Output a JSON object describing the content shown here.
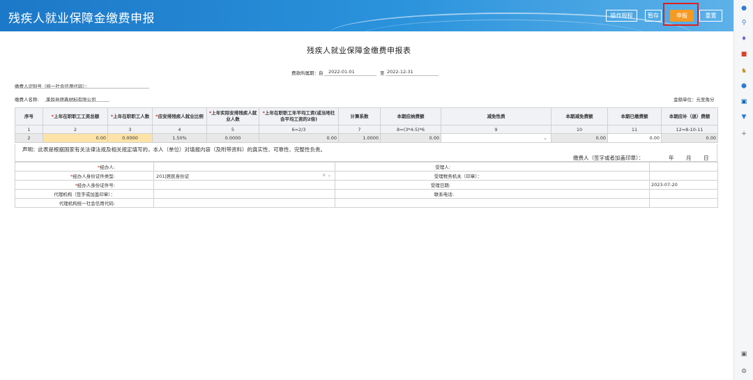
{
  "header": {
    "title": "残疾人就业保障金缴费申报",
    "buttons": {
      "op_guide": "操作规程",
      "save": "暂存",
      "submit": "申报",
      "reset": "重置"
    }
  },
  "sidebar": {
    "icons": [
      "bell-icon",
      "search-icon",
      "tag-icon",
      "briefcase-icon",
      "users-icon",
      "shield-icon",
      "outlook-icon",
      "funnel-icon",
      "plus-icon",
      "screen-icon",
      "gear-icon"
    ]
  },
  "form": {
    "doc_title": "残疾人就业保障金缴费申报表",
    "period_label": "费款所属期：自",
    "period_start": "2022-01-01",
    "period_to": "至",
    "period_end": "2022-12-31",
    "taxpayer_id_label": "缴费人识别号（统一社会信用代码）：",
    "taxpayer_id": "",
    "taxpayer_name_label": "缴费人名称:",
    "taxpayer_name": "莱龄县德鑫材料有限公司",
    "unit": "金额单位：元至角分"
  },
  "table": {
    "headers": [
      {
        "req": "",
        "text": "序号"
      },
      {
        "req": "*",
        "text": "上年在职职工工资总额"
      },
      {
        "req": "*",
        "text": "上年在职职工人数"
      },
      {
        "req": "*",
        "text": "应安排残疾人就业比例"
      },
      {
        "req": "*",
        "text": "上年实际安排残疾人就业人数"
      },
      {
        "req": "*",
        "text": "上年在职职工年平均工资(或当地社会平均工资的2倍)"
      },
      {
        "req": "",
        "text": "计算系数"
      },
      {
        "req": "",
        "text": "本期应纳费额"
      },
      {
        "req": "",
        "text": "减免性质"
      },
      {
        "req": "",
        "text": "本期减免费额"
      },
      {
        "req": "",
        "text": "本期已缴费额"
      },
      {
        "req": "",
        "text": "本期应补（退）费额"
      }
    ],
    "index_row": [
      "1",
      "2",
      "3",
      "4",
      "5",
      "6=2/3",
      "7",
      "8=(3*4-5)*6",
      "9",
      "10",
      "11",
      "12=8-10-11"
    ],
    "data_row": [
      "2",
      "0.00",
      "0.0000",
      "1.50%",
      "0.0000",
      "0.00",
      "1.0000",
      "0.00",
      "",
      "0.00",
      "0.00",
      "0.00"
    ]
  },
  "declaration": {
    "text": "声明：此表是根据国家有关法律法规及相关规定填写的，本人（单位）对填报内容（及附带资料）的真实性、可靠性、完整性负责。",
    "sign": "缴费人（签字或者加盖印章）：",
    "year": "年",
    "month": "月",
    "day": "日"
  },
  "info": {
    "agent": "经办人:",
    "agent_id_type": "经办人身份证件类型:",
    "agent_id_type_value": "201|居民身份证",
    "agent_id_no": "经办人身份证件号:",
    "agency": "代理机构（签字或加盖印章）：",
    "agency_code": "代理机构统一社会信用代码:",
    "receiver": "受理人:",
    "tax_office": "受理税务机关（印章）：",
    "receive_date": "受理日期:",
    "receive_date_value": "2023-07-20",
    "phone": "联系电话:"
  }
}
